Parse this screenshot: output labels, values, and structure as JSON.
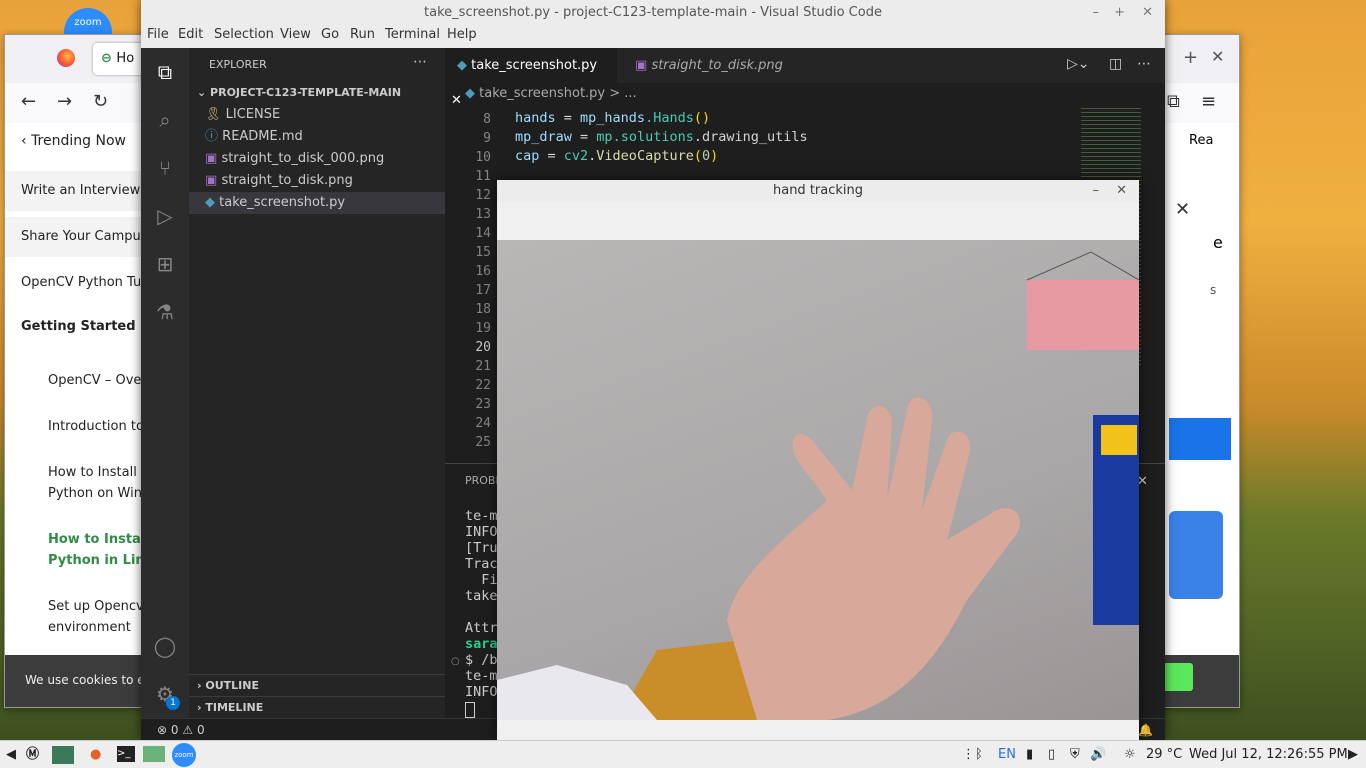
{
  "desktop": {
    "icon_label": "zoom"
  },
  "firefox": {
    "tab_title": "Ho",
    "sidebar": {
      "trending": "Trending Now",
      "items": [
        "Write an Interview Ex",
        "Share Your Campus E",
        "OpenCV Python Tuto",
        "Getting Started"
      ],
      "subitems": [
        "OpenCV – Overv",
        "Introduction to C",
        "How to Install O",
        "Python on Wind",
        "How to Install O",
        "Python in Linux",
        "Set up Opencv w",
        "environment"
      ]
    },
    "right_labels": {
      "read": "Rea",
      "letter_e": "e",
      "letter_s": "s"
    },
    "cookie_text": "We use cookies to en"
  },
  "vscode": {
    "title": "take_screenshot.py - project-C123-template-main - Visual Studio Code",
    "menu": [
      "File",
      "Edit",
      "Selection",
      "View",
      "Go",
      "Run",
      "Terminal",
      "Help"
    ],
    "explorer_label": "EXPLORER",
    "project": "PROJECT-C123-TEMPLATE-MAIN",
    "files": [
      "LICENSE",
      "README.md",
      "straight_to_disk_000.png",
      "straight_to_disk.png",
      "take_screenshot.py"
    ],
    "outline": "OUTLINE",
    "timeline": "TIMELINE",
    "tabs": [
      "take_screenshot.py",
      "straight_to_disk.png"
    ],
    "breadcrumb": "take_screenshot.py > ...",
    "line_numbers": [
      "8",
      "9",
      "10",
      "11",
      "12",
      "13",
      "14",
      "15",
      "16",
      "17",
      "18",
      "19",
      "20",
      "21",
      "22",
      "23",
      "24",
      "25"
    ],
    "code": {
      "l8_var": "hands",
      "l8_eq": " = ",
      "l8_mod": "mp_hands",
      "l8_fn": ".Hands",
      "l8_par": "()",
      "l9_var": "mp_draw",
      "l9_eq": " = ",
      "l9_mod": "mp",
      "l9_attr": ".solutions",
      "l9_end": ".drawing_utils",
      "l10_var": "cap",
      "l10_eq": " = ",
      "l10_mod": "cv2",
      "l10_fn": ".VideoCapture",
      "l10_open": "(",
      "l10_num": "0",
      "l10_close": ")"
    },
    "panel_tab": "PROBL",
    "terminal_lines": [
      "te-m",
      "INFO",
      "[Tru",
      "Trac",
      "  Fi",
      "take",
      "",
      "Attr",
      "sara",
      "$ /b",
      "te-m",
      "INFO"
    ],
    "status": {
      "errors": "0",
      "warnings": "0"
    },
    "account_badge": "1"
  },
  "hand_window": {
    "title": "hand tracking"
  },
  "taskbar": {
    "lang": "EN",
    "temp": "29 °C",
    "clock": "Wed Jul 12, 12:26:55 PM",
    "zoom": "zoom"
  }
}
